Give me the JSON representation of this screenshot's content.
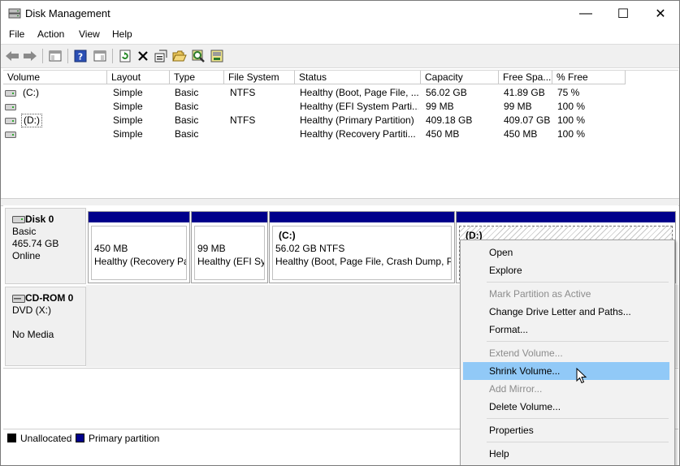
{
  "window": {
    "title": "Disk Management",
    "minimize": "—",
    "maximize": "☐",
    "close": "✕"
  },
  "menu": [
    "File",
    "Action",
    "View",
    "Help"
  ],
  "columns": [
    "Volume",
    "Layout",
    "Type",
    "File System",
    "Status",
    "Capacity",
    "Free Spa...",
    "% Free"
  ],
  "volumes": [
    {
      "volume": "(C:)",
      "layout": "Simple",
      "type": "Basic",
      "fs": "NTFS",
      "status": "Healthy (Boot, Page File, ...",
      "capacity": "56.02 GB",
      "free": "41.89 GB",
      "pct": "75 %"
    },
    {
      "volume": "",
      "layout": "Simple",
      "type": "Basic",
      "fs": "",
      "status": "Healthy (EFI System Parti...",
      "capacity": "99 MB",
      "free": "99 MB",
      "pct": "100 %"
    },
    {
      "volume": "(D:)",
      "layout": "Simple",
      "type": "Basic",
      "fs": "NTFS",
      "status": "Healthy (Primary Partition)",
      "capacity": "409.18 GB",
      "free": "409.07 GB",
      "pct": "100 %"
    },
    {
      "volume": "",
      "layout": "Simple",
      "type": "Basic",
      "fs": "",
      "status": "Healthy (Recovery Partiti...",
      "capacity": "450 MB",
      "free": "450 MB",
      "pct": "100 %"
    }
  ],
  "disk0": {
    "name": "Disk 0",
    "type": "Basic",
    "size": "465.74 GB",
    "status": "Online",
    "partitions": [
      {
        "label": "",
        "size": "450 MB",
        "status": "Healthy (Recovery Pa"
      },
      {
        "label": "",
        "size": "99 MB",
        "status": "Healthy (EFI Sy:"
      },
      {
        "label": "(C:)",
        "size": "56.02 GB NTFS",
        "status": "Healthy (Boot, Page File, Crash Dump, Pı"
      },
      {
        "label": "(D:)",
        "size": "",
        "status": ""
      }
    ]
  },
  "cdrom0": {
    "name": "CD-ROM 0",
    "drive": "DVD (X:)",
    "media": "No Media"
  },
  "legend": {
    "unallocated": "Unallocated",
    "primary": "Primary partition"
  },
  "colors": {
    "primary": "#00008b",
    "unallocated": "#000000",
    "highlight": "#91c9f7"
  },
  "context_menu": [
    {
      "label": "Open",
      "enabled": true
    },
    {
      "label": "Explore",
      "enabled": true
    },
    {
      "label": "Mark Partition as Active",
      "enabled": false
    },
    {
      "label": "Change Drive Letter and Paths...",
      "enabled": true
    },
    {
      "label": "Format...",
      "enabled": true
    },
    {
      "label": "Extend Volume...",
      "enabled": false
    },
    {
      "label": "Shrink Volume...",
      "enabled": true,
      "highlighted": true
    },
    {
      "label": "Add Mirror...",
      "enabled": false
    },
    {
      "label": "Delete Volume...",
      "enabled": true
    },
    {
      "label": "Properties",
      "enabled": true
    },
    {
      "label": "Help",
      "enabled": true
    }
  ]
}
